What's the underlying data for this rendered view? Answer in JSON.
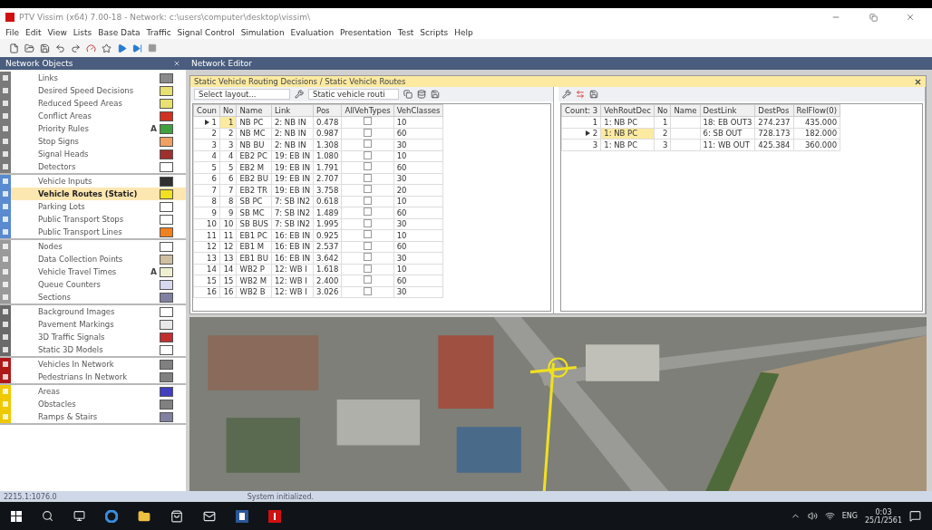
{
  "window": {
    "title": "PTV Vissim (x64) 7.00-18 - Network: c:\\users\\computer\\desktop\\vissim\\"
  },
  "menu": [
    "File",
    "Edit",
    "View",
    "Lists",
    "Base Data",
    "Traffic",
    "Signal Control",
    "Simulation",
    "Evaluation",
    "Presentation",
    "Test",
    "Scripts",
    "Help"
  ],
  "panel": {
    "title": "Network Objects",
    "groups": [
      {
        "color": "#7a7a7a",
        "items": [
          {
            "label": "Links",
            "selected": false,
            "color": "#8a8a8a"
          },
          {
            "label": "Desired Speed Decisions",
            "selected": false,
            "color": "#e8e070"
          },
          {
            "label": "Reduced Speed Areas",
            "selected": false,
            "color": "#e8e070"
          },
          {
            "label": "Conflict Areas",
            "selected": false,
            "color": "#d03020"
          },
          {
            "label": "Priority Rules",
            "selected": false,
            "mark": "A",
            "color": "#40a040"
          },
          {
            "label": "Stop Signs",
            "selected": false,
            "color": "#f0a060"
          },
          {
            "label": "Signal Heads",
            "selected": false,
            "color": "#a03030"
          },
          {
            "label": "Detectors",
            "selected": false,
            "color": "#ffffff"
          }
        ]
      },
      {
        "color": "#5a8ad0",
        "items": [
          {
            "label": "Vehicle Inputs",
            "selected": false,
            "color": "#303030"
          },
          {
            "label": "Vehicle Routes (Static)",
            "selected": true,
            "color": "#f0e020"
          },
          {
            "label": "Parking Lots",
            "selected": false,
            "color": "#ffffff"
          },
          {
            "label": "Public Transport Stops",
            "selected": false,
            "color": "#ffffff"
          },
          {
            "label": "Public Transport Lines",
            "selected": false,
            "color": "#f08020"
          }
        ]
      },
      {
        "color": "#9a9a9a",
        "items": [
          {
            "label": "Nodes",
            "selected": false,
            "color": "#ffffff"
          },
          {
            "label": "Data Collection Points",
            "selected": false,
            "color": "#d0c0a0"
          },
          {
            "label": "Vehicle Travel Times",
            "selected": false,
            "mark": "A",
            "color": "#f0f0d0"
          },
          {
            "label": "Queue Counters",
            "selected": false,
            "color": "#d8d8f0"
          },
          {
            "label": "Sections",
            "selected": false,
            "color": "#8080a0"
          }
        ]
      },
      {
        "color": "#6a6a6a",
        "items": [
          {
            "label": "Background Images",
            "selected": false,
            "color": "#ffffff"
          },
          {
            "label": "Pavement Markings",
            "selected": false,
            "color": "#e8e8e8"
          },
          {
            "label": "3D Traffic Signals",
            "selected": false,
            "color": "#c03030"
          },
          {
            "label": "Static 3D Models",
            "selected": false,
            "color": "#ffffff"
          }
        ]
      },
      {
        "color": "#b01818",
        "items": [
          {
            "label": "Vehicles In Network",
            "selected": false,
            "color": "#808080"
          },
          {
            "label": "Pedestrians In Network",
            "selected": false,
            "color": "#808080"
          }
        ]
      },
      {
        "color": "#f0c800",
        "items": [
          {
            "label": "Areas",
            "selected": false,
            "color": "#4040c0"
          },
          {
            "label": "Obstacles",
            "selected": false,
            "color": "#808080"
          },
          {
            "label": "Ramps & Stairs",
            "selected": false,
            "color": "#8080a0"
          }
        ]
      }
    ]
  },
  "editor": {
    "title": "Network Editor"
  },
  "list_window": {
    "title": "Static Vehicle Routing Decisions / Static Vehicle Routes",
    "layout_placeholder": "Select layout...",
    "list_select": "Static vehicle routi",
    "left_table": {
      "columns": [
        "Coun",
        "No",
        "Name",
        "Link",
        "Pos",
        "AllVehTypes",
        "VehClasses"
      ],
      "rows": [
        {
          "cells": [
            "1",
            "1",
            "NB PC",
            "2: NB IN",
            "0.478",
            "10"
          ],
          "all_veh_types": false,
          "selected": true
        },
        {
          "cells": [
            "2",
            "2",
            "NB MC",
            "2: NB IN",
            "0.987",
            "60"
          ],
          "all_veh_types": false,
          "selected": false
        },
        {
          "cells": [
            "3",
            "3",
            "NB BU",
            "2: NB IN",
            "1.308",
            "30"
          ],
          "all_veh_types": false,
          "selected": false
        },
        {
          "cells": [
            "4",
            "4",
            "EB2 PC",
            "19: EB IN",
            "1.080",
            "10"
          ],
          "all_veh_types": false,
          "selected": false
        },
        {
          "cells": [
            "5",
            "5",
            "EB2 M",
            "19: EB IN",
            "1.791",
            "60"
          ],
          "all_veh_types": false,
          "selected": false
        },
        {
          "cells": [
            "6",
            "6",
            "EB2 BU",
            "19: EB IN",
            "2.707",
            "30"
          ],
          "all_veh_types": false,
          "selected": false
        },
        {
          "cells": [
            "7",
            "7",
            "EB2 TR",
            "19: EB IN",
            "3.758",
            "20"
          ],
          "all_veh_types": false,
          "selected": false
        },
        {
          "cells": [
            "8",
            "8",
            "SB PC",
            "7: SB IN2",
            "0.618",
            "10"
          ],
          "all_veh_types": false,
          "selected": false
        },
        {
          "cells": [
            "9",
            "9",
            "SB MC",
            "7: SB IN2",
            "1.489",
            "60"
          ],
          "all_veh_types": false,
          "selected": false
        },
        {
          "cells": [
            "10",
            "10",
            "SB BUS",
            "7: SB IN2",
            "1.995",
            "30"
          ],
          "all_veh_types": false,
          "selected": false
        },
        {
          "cells": [
            "11",
            "11",
            "EB1 PC",
            "16: EB IN",
            "0.925",
            "10"
          ],
          "all_veh_types": false,
          "selected": false
        },
        {
          "cells": [
            "12",
            "12",
            "EB1 M",
            "16: EB IN",
            "2.537",
            "60"
          ],
          "all_veh_types": false,
          "selected": false
        },
        {
          "cells": [
            "13",
            "13",
            "EB1 BU",
            "16: EB IN",
            "3.642",
            "30"
          ],
          "all_veh_types": false,
          "selected": false
        },
        {
          "cells": [
            "14",
            "14",
            "WB2 P",
            "12: WB I",
            "1.618",
            "10"
          ],
          "all_veh_types": false,
          "selected": false
        },
        {
          "cells": [
            "15",
            "15",
            "WB2 M",
            "12: WB I",
            "2.400",
            "60"
          ],
          "all_veh_types": false,
          "selected": false
        },
        {
          "cells": [
            "16",
            "16",
            "WB2 B",
            "12: WB I",
            "3.026",
            "30"
          ],
          "all_veh_types": false,
          "selected": false
        }
      ]
    },
    "right_table": {
      "columns": [
        "Count: 3",
        "VehRoutDec",
        "No",
        "Name",
        "DestLink",
        "DestPos",
        "RelFlow(0)"
      ],
      "rows": [
        {
          "cells": [
            "1",
            "1: NB PC",
            "1",
            "",
            "18: EB OUT3",
            "274.237",
            "435.000"
          ],
          "selected": false
        },
        {
          "cells": [
            "2",
            "1: NB PC",
            "2",
            "",
            "6: SB OUT",
            "728.173",
            "182.000"
          ],
          "selected": true
        },
        {
          "cells": [
            "3",
            "1: NB PC",
            "3",
            "",
            "11: WB OUT",
            "425.384",
            "360.000"
          ],
          "selected": false
        }
      ]
    }
  },
  "status_bar": {
    "coords": "2215.1:1076.0",
    "message": "System initialized."
  },
  "taskbar": {
    "language": "ENG",
    "time": "0:03",
    "date": "25/1/2561"
  }
}
